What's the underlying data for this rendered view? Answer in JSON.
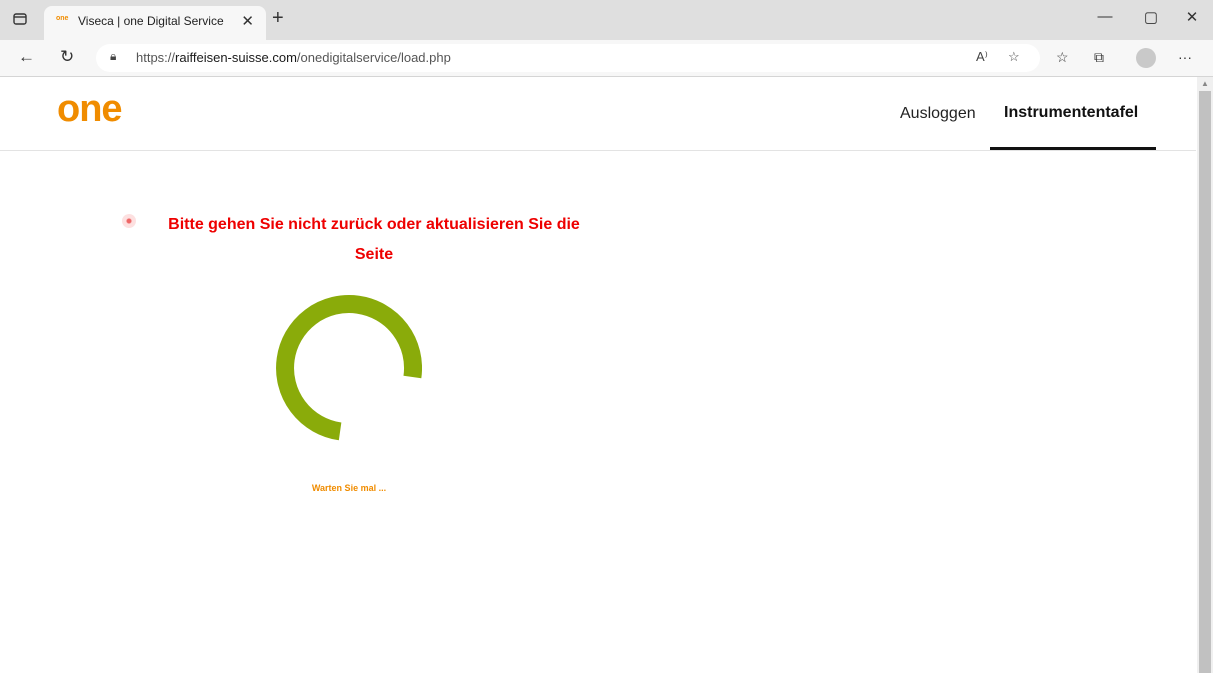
{
  "browser": {
    "tab_title": "Viseca | one Digital Service",
    "tab_favicon_text": "one",
    "url_prefix": "https://",
    "url_host": "raiffeisen-suisse.com",
    "url_path": "/onedigitalservice/load.php"
  },
  "site": {
    "logo": "one",
    "nav": {
      "logout": "Ausloggen",
      "dashboard": "Instrumententafel"
    },
    "warning": "Bitte gehen Sie nicht zurück oder aktualisieren Sie die Seite",
    "wait_text": "Warten Sie mal ...",
    "colors": {
      "brand": "#f08c00",
      "warning": "#ee0000",
      "spinner": "#8aab0a"
    }
  },
  "icons": {
    "tab_actions": "tab-actions-icon",
    "close": "close-icon",
    "new_tab": "plus-icon",
    "back": "back-arrow-icon",
    "refresh": "refresh-icon",
    "lock": "lock-icon",
    "read_aloud": "read-aloud-icon",
    "favorite": "add-favorite-icon",
    "favorites": "favorites-icon",
    "collections": "collections-icon",
    "profile": "profile-icon",
    "more": "more-icon"
  }
}
